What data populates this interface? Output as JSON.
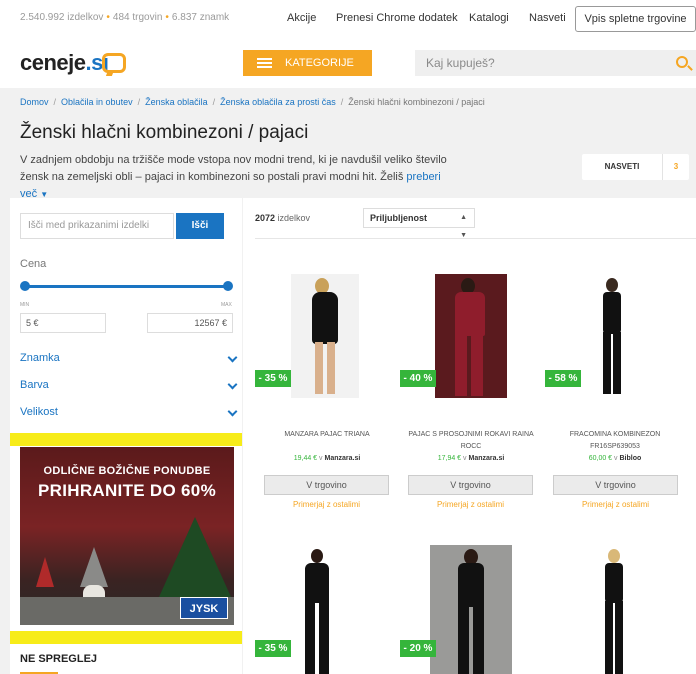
{
  "topbar": {
    "stats": [
      "2.540.992 izdelkov",
      "484 trgovin",
      "6.837 znamk"
    ],
    "links": [
      "Akcije",
      "Prenesi Chrome dodatek",
      "Katalogi",
      "Nasveti"
    ],
    "shop_button": "Vpis spletne trgovine"
  },
  "header": {
    "logo_main": "ceneje",
    "logo_suffix": ".si",
    "categories_label": "KATEGORIJE",
    "search_placeholder": "Kaj kupuješ?"
  },
  "breadcrumb": [
    "Domov",
    "Oblačila in obutev",
    "Ženska oblačila",
    "Ženska oblačila za prosti čas",
    "Ženski hlačni kombinezoni / pajaci"
  ],
  "page": {
    "title": "Ženski hlačni kombinezoni / pajaci",
    "intro_line1": "V zadnjem obdobju na tržišče mode vstopa nov modni trend, ki je navdušil veliko število",
    "intro_line2": "žensk na zemeljski obli – pajaci in kombinezoni so postali pravi modni hit. Želiš",
    "read_more": "preberi več",
    "tips_label": "NASVETI",
    "tips_count": "3"
  },
  "sidebar": {
    "search_placeholder": "Išči med prikazanimi izdelki",
    "search_button": "Išči",
    "price_label": "Cena",
    "min_label": "MIN",
    "max_label": "MAX",
    "min_value": "5 €",
    "max_value": "12567 €",
    "slider_range": [
      0,
      1
    ],
    "facets": [
      "Znamka",
      "Barva",
      "Velikost"
    ],
    "ad": {
      "line1": "ODLIČNE BOŽIČNE PONUDBE",
      "line2": "PRIHRANITE DO 60%",
      "brand": "JYSK"
    },
    "dont_miss": "NE SPREGLEJ"
  },
  "main": {
    "count_number": "2072",
    "count_label": "izdelkov",
    "sort_value": "Priljubljenost",
    "store_button": "V trgovino",
    "compare_link": "Primerjaj z ostalimi",
    "price_connector": "v",
    "products": [
      {
        "name": "MANZARA PAJAC TRIANA",
        "price": "19,44 €",
        "shop": "Manzara.si",
        "discount": "- 35 %"
      },
      {
        "name": "PAJAC S PROSOJNIMI ROKAVI RAINA ROCC",
        "price": "17,94 €",
        "shop": "Manzara.si",
        "discount": "- 40 %"
      },
      {
        "name": "FRACOMINA KOMBINEZON FR16SP639053",
        "price": "60,00 €",
        "shop": "Bibloo",
        "discount": "- 58 %"
      },
      {
        "name": "",
        "price": "",
        "shop": "",
        "discount": "- 35 %"
      },
      {
        "name": "",
        "price": "",
        "shop": "",
        "discount": "- 20 %"
      },
      {
        "name": "",
        "price": "",
        "shop": "",
        "discount": ""
      }
    ]
  },
  "colors": {
    "accent": "#f5a623",
    "brand_blue": "#1a74c2",
    "discount_green": "#35b53b",
    "ad_yellow": "#f7ec19"
  }
}
